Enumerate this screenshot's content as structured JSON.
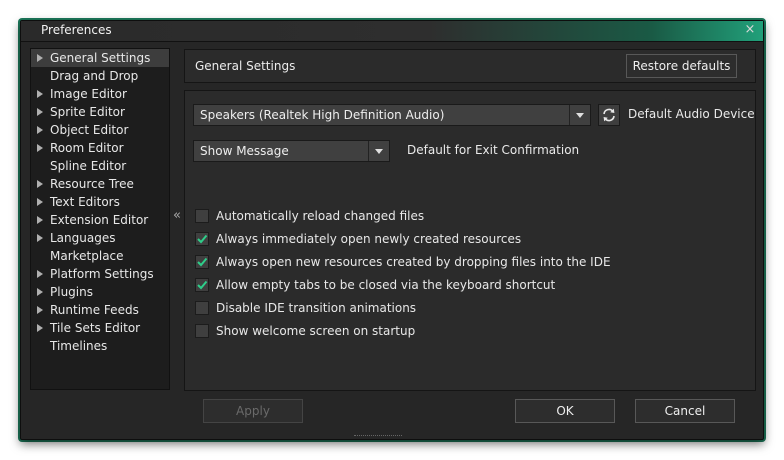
{
  "window": {
    "title": "Preferences",
    "close_glyph": "×"
  },
  "sidebar": {
    "items": [
      {
        "label": "General Settings",
        "expandable": true,
        "selected": true
      },
      {
        "label": "Drag and Drop",
        "expandable": false
      },
      {
        "label": "Image Editor",
        "expandable": true
      },
      {
        "label": "Sprite Editor",
        "expandable": true
      },
      {
        "label": "Object Editor",
        "expandable": true
      },
      {
        "label": "Room Editor",
        "expandable": true
      },
      {
        "label": "Spline Editor",
        "expandable": false
      },
      {
        "label": "Resource Tree",
        "expandable": true
      },
      {
        "label": "Text Editors",
        "expandable": true
      },
      {
        "label": "Extension Editor",
        "expandable": true
      },
      {
        "label": "Languages",
        "expandable": true
      },
      {
        "label": "Marketplace",
        "expandable": false
      },
      {
        "label": "Platform Settings",
        "expandable": true
      },
      {
        "label": "Plugins",
        "expandable": true
      },
      {
        "label": "Runtime Feeds",
        "expandable": true
      },
      {
        "label": "Tile Sets Editor",
        "expandable": true
      },
      {
        "label": "Timelines",
        "expandable": false
      }
    ],
    "collapse_glyph": "«"
  },
  "header": {
    "title": "General Settings",
    "restore_label": "Restore defaults"
  },
  "audio": {
    "device_value": "Speakers (Realtek High Definition Audio)",
    "device_label": "Default Audio Device",
    "refresh_icon": "refresh-icon"
  },
  "exit_confirm": {
    "value": "Show Message",
    "label": "Default for Exit Confirmation"
  },
  "checkboxes": [
    {
      "label": "Automatically reload changed files",
      "checked": false
    },
    {
      "label": "Always immediately open newly created resources",
      "checked": true
    },
    {
      "label": "Always open new resources created by dropping files into the IDE",
      "checked": true
    },
    {
      "label": "Allow empty tabs to be closed via the keyboard shortcut",
      "checked": true
    },
    {
      "label": "Disable IDE transition animations",
      "checked": false
    },
    {
      "label": "Show welcome screen on startup",
      "checked": false
    }
  ],
  "footer": {
    "apply_label": "Apply",
    "ok_label": "OK",
    "cancel_label": "Cancel"
  },
  "colors": {
    "accent": "#1d7a5c",
    "check": "#2ecf8a",
    "background": "#262626"
  }
}
